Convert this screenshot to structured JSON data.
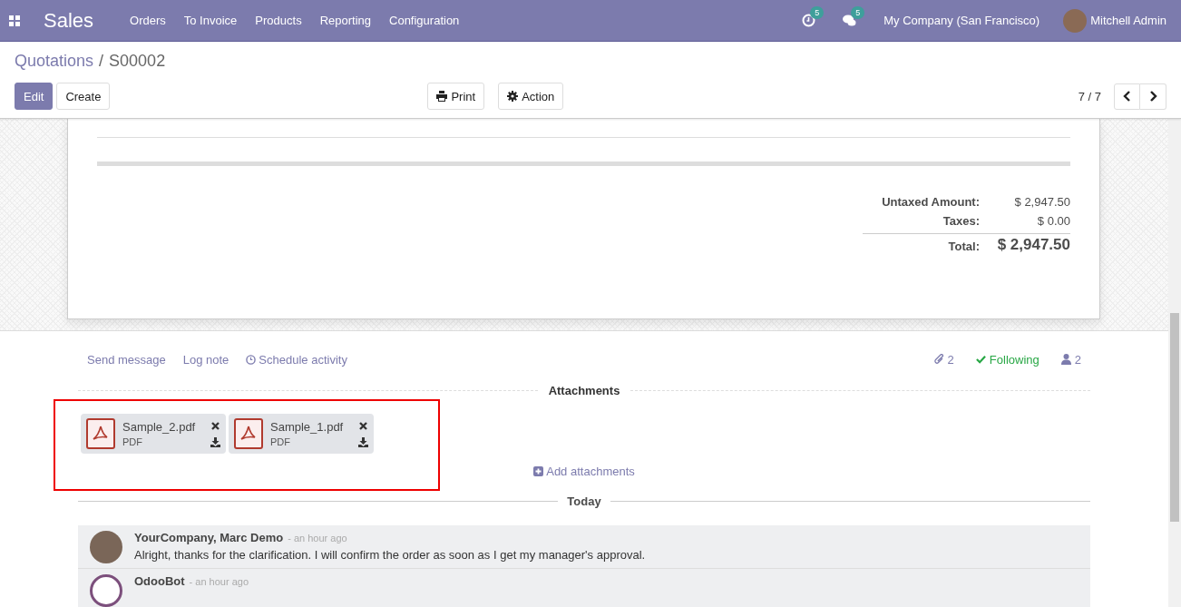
{
  "navbar": {
    "app_name": "Sales",
    "menu": [
      "Orders",
      "To Invoice",
      "Products",
      "Reporting",
      "Configuration"
    ],
    "activity_count": "5",
    "message_count": "5",
    "company": "My Company (San Francisco)",
    "user": "Mitchell Admin"
  },
  "breadcrumb": {
    "parent": "Quotations",
    "separator": "/",
    "current": "S00002"
  },
  "buttons": {
    "edit": "Edit",
    "create": "Create",
    "print": "Print",
    "action": "Action"
  },
  "pager": {
    "value": "7 / 7"
  },
  "totals": [
    {
      "kind": "line",
      "label": "Untaxed Amount:",
      "value": "$ 2,947.50"
    },
    {
      "kind": "line",
      "label": "Taxes:",
      "value": "$ 0.00"
    },
    {
      "kind": "total",
      "label": "Total:",
      "value": "$ 2,947.50"
    }
  ],
  "chatter": {
    "actions": [
      {
        "kind": "plain",
        "label": "Send message"
      },
      {
        "kind": "plain",
        "label": "Log note"
      },
      {
        "kind": "activity",
        "label": "Schedule activity"
      }
    ],
    "attachment_count": "2",
    "follow_label": "Following",
    "follower_count": "2",
    "attachments_title": "Attachments",
    "attachments": [
      {
        "name": "Sample_2.pdf",
        "type": "PDF"
      },
      {
        "name": "Sample_1.pdf",
        "type": "PDF"
      }
    ],
    "add_attachments": "Add attachments",
    "date_separator": "Today",
    "messages": [
      {
        "kind": "person",
        "author": "YourCompany, Marc Demo",
        "time": "- an hour ago",
        "body": "Alright, thanks for the clarification. I will confirm the order as soon as I get my manager's approval."
      },
      {
        "kind": "bot",
        "author": "OdooBot",
        "time": "- an hour ago"
      }
    ]
  }
}
